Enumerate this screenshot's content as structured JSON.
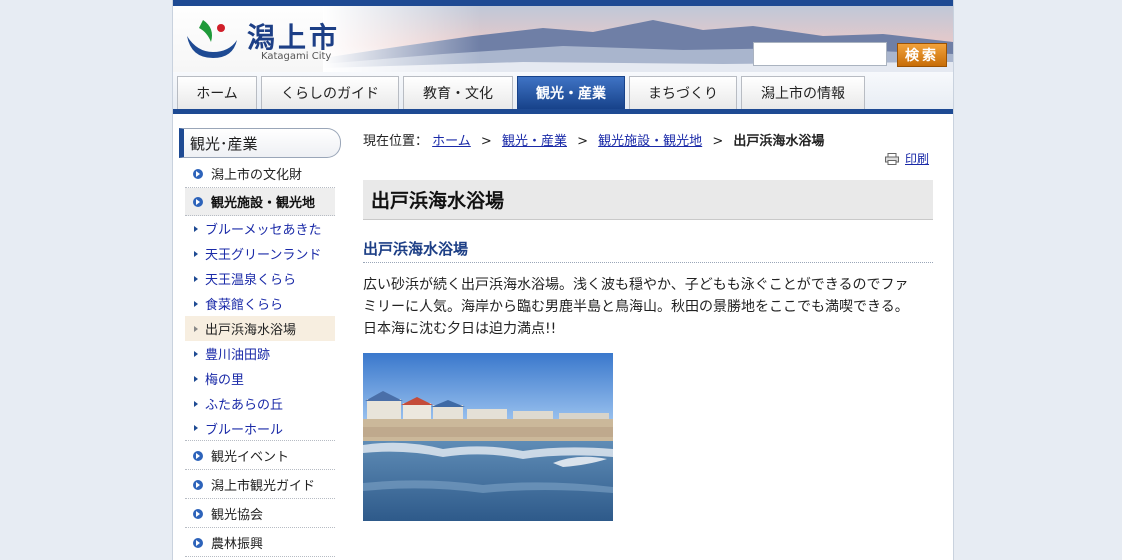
{
  "header": {
    "site_name": "潟上市",
    "site_name_en": "Katagami City",
    "search_placeholder": "",
    "search_button": "検索"
  },
  "nav": {
    "items": [
      "ホーム",
      "くらしのガイド",
      "教育・文化",
      "観光・産業",
      "まちづくり",
      "潟上市の情報"
    ],
    "active_index": 3
  },
  "sidebar": {
    "title": "観光･産業",
    "items": [
      {
        "label": "潟上市の文化財",
        "level": "major"
      },
      {
        "label": "観光施設・観光地",
        "level": "major",
        "current": true
      },
      {
        "label": "ブルーメッセあきた",
        "level": "sub"
      },
      {
        "label": "天王グリーンランド",
        "level": "sub"
      },
      {
        "label": "天王温泉くらら",
        "level": "sub"
      },
      {
        "label": "食菜館くらら",
        "level": "sub"
      },
      {
        "label": "出戸浜海水浴場",
        "level": "sub",
        "current": true
      },
      {
        "label": "豊川油田跡",
        "level": "sub"
      },
      {
        "label": "梅の里",
        "level": "sub"
      },
      {
        "label": "ふたあらの丘",
        "level": "sub"
      },
      {
        "label": "ブルーホール",
        "level": "sub"
      },
      {
        "label": "観光イベント",
        "level": "major"
      },
      {
        "label": "潟上市観光ガイド",
        "level": "major"
      },
      {
        "label": "観光協会",
        "level": "major"
      },
      {
        "label": "農林振興",
        "level": "major"
      }
    ]
  },
  "breadcrumb": {
    "prefix": "現在位置：",
    "links": [
      "ホーム",
      "観光・産業",
      "観光施設・観光地"
    ],
    "separator": ">",
    "current": "出戸浜海水浴場"
  },
  "print_label": "印刷",
  "page_title": "出戸浜海水浴場",
  "section_heading": "出戸浜海水浴場",
  "body_lines": [
    "広い砂浜が続く出戸浜海水浴場。浅く波も穏やか、子どもも泳ぐことができるのでファ",
    "ミリーに人気。海岸から臨む男鹿半島と鳥海山。秋田の景勝地をここでも満喫できる。",
    "日本海に沈む夕日は迫力満点!!"
  ],
  "colors": {
    "brand_blue": "#1e4a93",
    "link": "#1a2aa8",
    "search_orange": "#e08a1e"
  }
}
